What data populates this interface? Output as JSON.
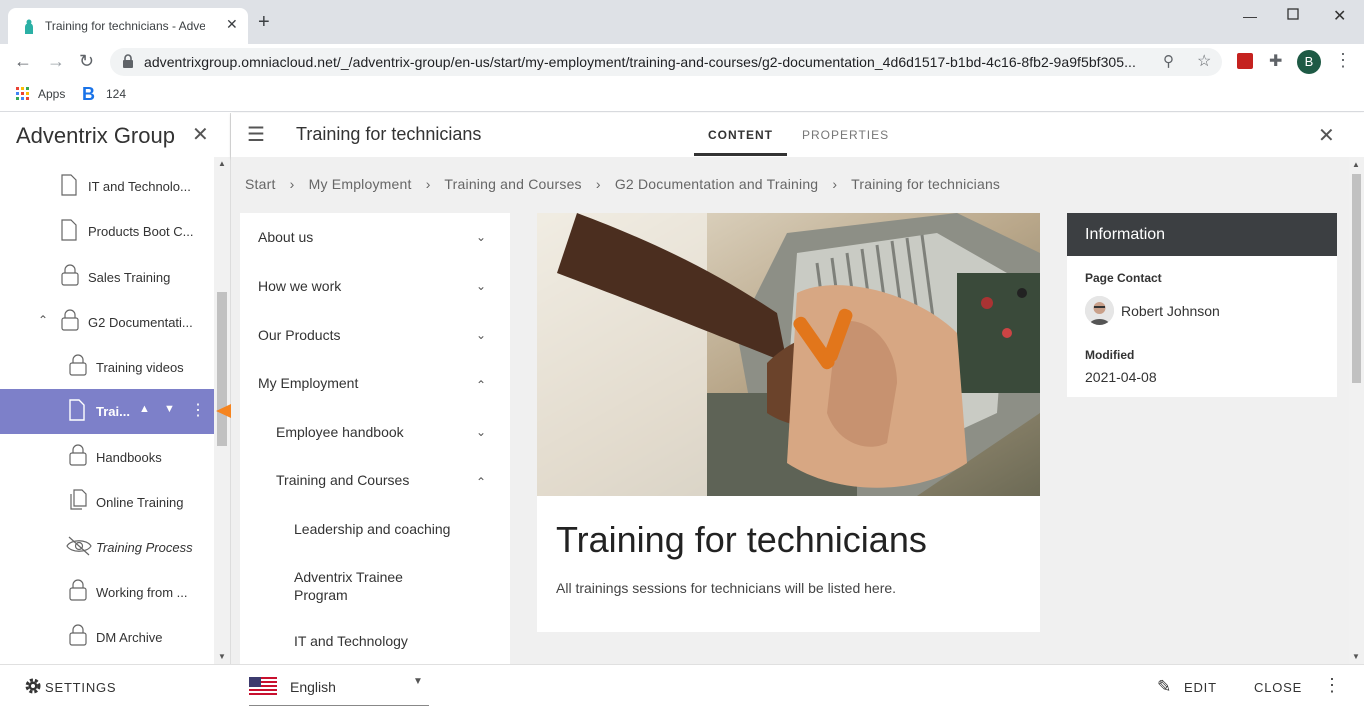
{
  "browser": {
    "tab_title": "Training for technicians - Adventrix",
    "url": "adventrixgroup.omniacloud.net/_/adventrix-group/en-us/start/my-employment/training-and-courses/g2-documentation_4d6d1517-b1bd-4c16-8fb2-9a9f5bf305...",
    "bookmarks": [
      {
        "label": "Apps"
      },
      {
        "label": "124"
      }
    ],
    "profile_initial": "B"
  },
  "left_panel": {
    "title": "Adventrix Group",
    "items": [
      {
        "label": "IT and Technolo...",
        "icon": "page-icon"
      },
      {
        "label": "Products Boot C...",
        "icon": "page-icon"
      },
      {
        "label": "Sales Training",
        "icon": "lock-icon"
      },
      {
        "label": "G2 Documentati...",
        "icon": "lock-icon"
      },
      {
        "label": "Training videos",
        "icon": "lock-icon"
      },
      {
        "label": "Trai...",
        "icon": "page-icon"
      },
      {
        "label": "Handbooks",
        "icon": "lock-icon"
      },
      {
        "label": "Online Training",
        "icon": "copy-icon"
      },
      {
        "label": "Training Process",
        "icon": "hidden-icon"
      },
      {
        "label": "Working from ...",
        "icon": "lock-icon"
      },
      {
        "label": "DM Archive",
        "icon": "lock-icon"
      }
    ]
  },
  "header": {
    "page_title": "Training for technicians",
    "tabs": [
      {
        "label": "CONTENT"
      },
      {
        "label": "PROPERTIES"
      }
    ]
  },
  "breadcrumb": [
    "Start",
    "My Employment",
    "Training and Courses",
    "G2 Documentation and Training",
    "Training for technicians"
  ],
  "side_nav": [
    {
      "label": "About us"
    },
    {
      "label": "How we work"
    },
    {
      "label": "Our Products"
    },
    {
      "label": "My Employment"
    },
    {
      "label": "Employee handbook"
    },
    {
      "label": "Training and Courses"
    },
    {
      "label": "Leadership and coaching"
    },
    {
      "label": "Adventrix Trainee Program"
    },
    {
      "label": "IT and Technology"
    }
  ],
  "article": {
    "heading": "Training for technicians",
    "body": "All trainings sessions for technicians will be listed here."
  },
  "info": {
    "heading": "Information",
    "contact_label": "Page Contact",
    "contact_name": "Robert Johnson",
    "modified_label": "Modified",
    "modified_value": "2021-04-08"
  },
  "footer": {
    "settings": "SETTINGS",
    "language": "English",
    "edit": "EDIT",
    "close": "CLOSE"
  },
  "colors": {
    "selected": "#7d80c9",
    "arrow": "#f5841f",
    "active_tab": "#333333"
  }
}
